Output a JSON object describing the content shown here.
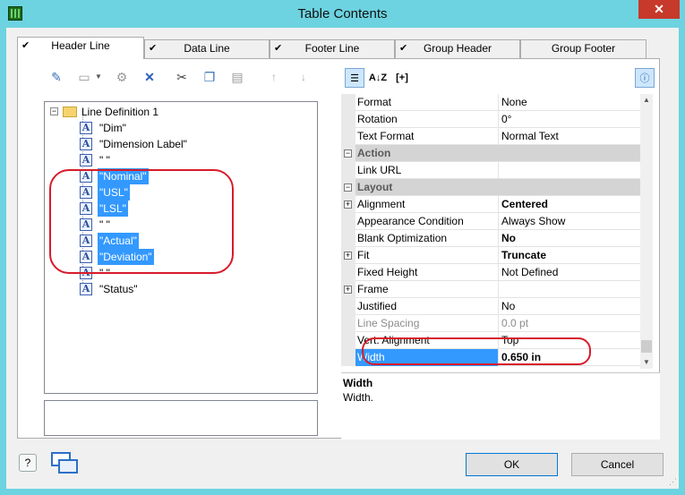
{
  "window": {
    "title": "Table Contents",
    "close_label": "✕"
  },
  "tabs": [
    {
      "label": "Header Line",
      "active": true
    },
    {
      "label": "Data Line",
      "active": false
    },
    {
      "label": "Footer Line",
      "active": false
    },
    {
      "label": "Group Header",
      "active": false
    },
    {
      "label": "Group Footer",
      "active": false
    }
  ],
  "tree": {
    "root": {
      "label": "Line Definition  1"
    },
    "items": [
      {
        "label": "\"Dim\"",
        "selected": false
      },
      {
        "label": "\"Dimension Label\"",
        "selected": false
      },
      {
        "label": "\" \"",
        "selected": false
      },
      {
        "label": "\"Nominal\"",
        "selected": true
      },
      {
        "label": "\"USL\"",
        "selected": true
      },
      {
        "label": "\"LSL\"",
        "selected": true
      },
      {
        "label": "\" \"",
        "selected": false
      },
      {
        "label": "\"Actual\"",
        "selected": true
      },
      {
        "label": "\"Deviation\"",
        "selected": true
      },
      {
        "label": "\" \"",
        "selected": false
      },
      {
        "label": "\"Status\"",
        "selected": false
      }
    ]
  },
  "properties": {
    "rows": [
      {
        "name": "Format",
        "value": "None"
      },
      {
        "name": "Rotation",
        "value": "0°"
      },
      {
        "name": "Text Format",
        "value": "Normal Text"
      },
      {
        "category": "Action"
      },
      {
        "name": "Link URL",
        "value": ""
      },
      {
        "category": "Layout"
      },
      {
        "name": "Alignment",
        "value": "Centered",
        "bold": true,
        "expandable": true
      },
      {
        "name": "Appearance Condition",
        "value": "Always Show"
      },
      {
        "name": "Blank Optimization",
        "value": "No",
        "bold": true
      },
      {
        "name": "Fit",
        "value": "Truncate",
        "bold": true,
        "expandable": true
      },
      {
        "name": "Fixed Height",
        "value": "Not Defined"
      },
      {
        "name": "Frame",
        "value": "",
        "expandable": true
      },
      {
        "name": "Justified",
        "value": "No"
      },
      {
        "name": "Line Spacing",
        "value": "0.0 pt",
        "disabled": true
      },
      {
        "name": "Vert. Alignment",
        "value": "Top"
      },
      {
        "name": "Width",
        "value": "0.650 in",
        "bold": true,
        "selected": true
      }
    ]
  },
  "description": {
    "title": "Width",
    "text": "Width."
  },
  "toolbar_right": {
    "sort_label": "A↓Z",
    "bracket_label": "[+]"
  },
  "buttons": {
    "ok": "OK",
    "cancel": "Cancel",
    "help": "?"
  }
}
